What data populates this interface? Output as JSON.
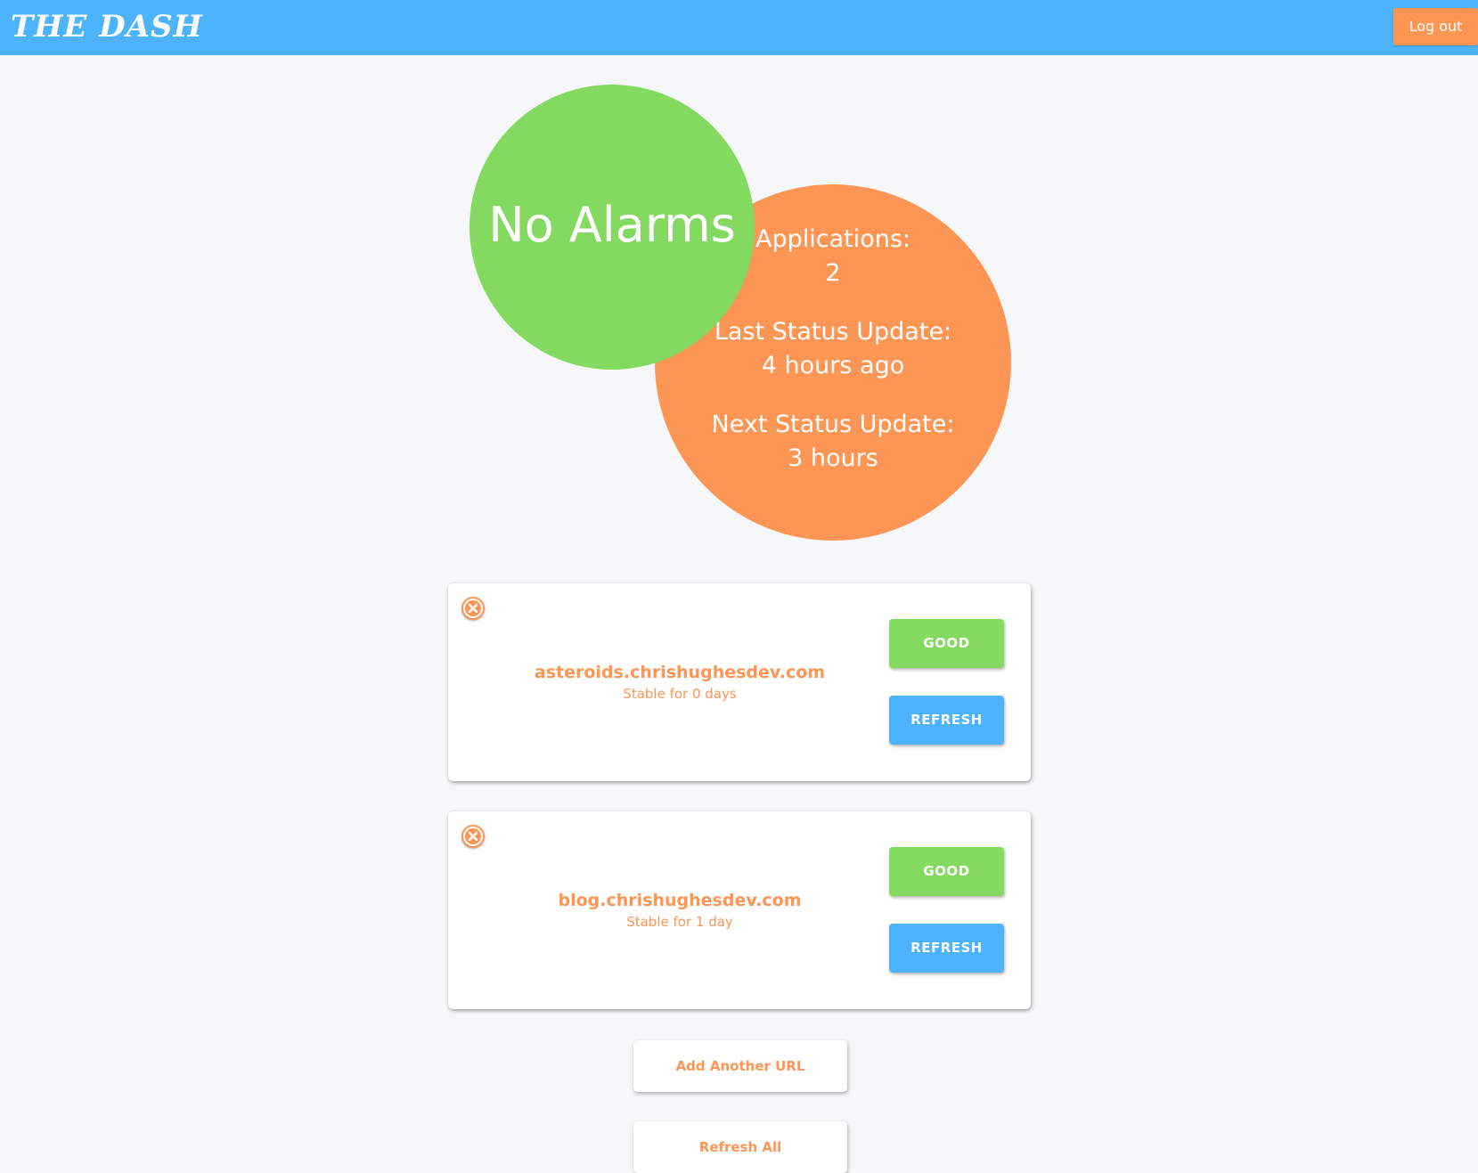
{
  "header": {
    "logo": "THE DASH",
    "logout_label": "Log out"
  },
  "summary": {
    "alarm_text": "No Alarms",
    "applications_label": "Applications:",
    "applications_value": "2",
    "last_update_label": "Last Status Update:",
    "last_update_value": "4 hours ago",
    "next_update_label": "Next Status Update:",
    "next_update_value": "3 hours"
  },
  "apps": [
    {
      "url": "asteroids.chrishughesdev.com",
      "stable": "Stable for 0 days",
      "status": "GOOD",
      "refresh": "REFRESH"
    },
    {
      "url": "blog.chrishughesdev.com",
      "stable": "Stable for 1 day",
      "status": "GOOD",
      "refresh": "REFRESH"
    }
  ],
  "actions": {
    "add_url": "Add Another URL",
    "refresh_all": "Refresh All"
  },
  "colors": {
    "header": "#4db3fd",
    "accent_orange": "#fd9555",
    "good_green": "#84da60",
    "refresh_blue": "#4db3fd",
    "background": "#f5f7f9"
  },
  "icons": {
    "remove": "close-icon"
  }
}
